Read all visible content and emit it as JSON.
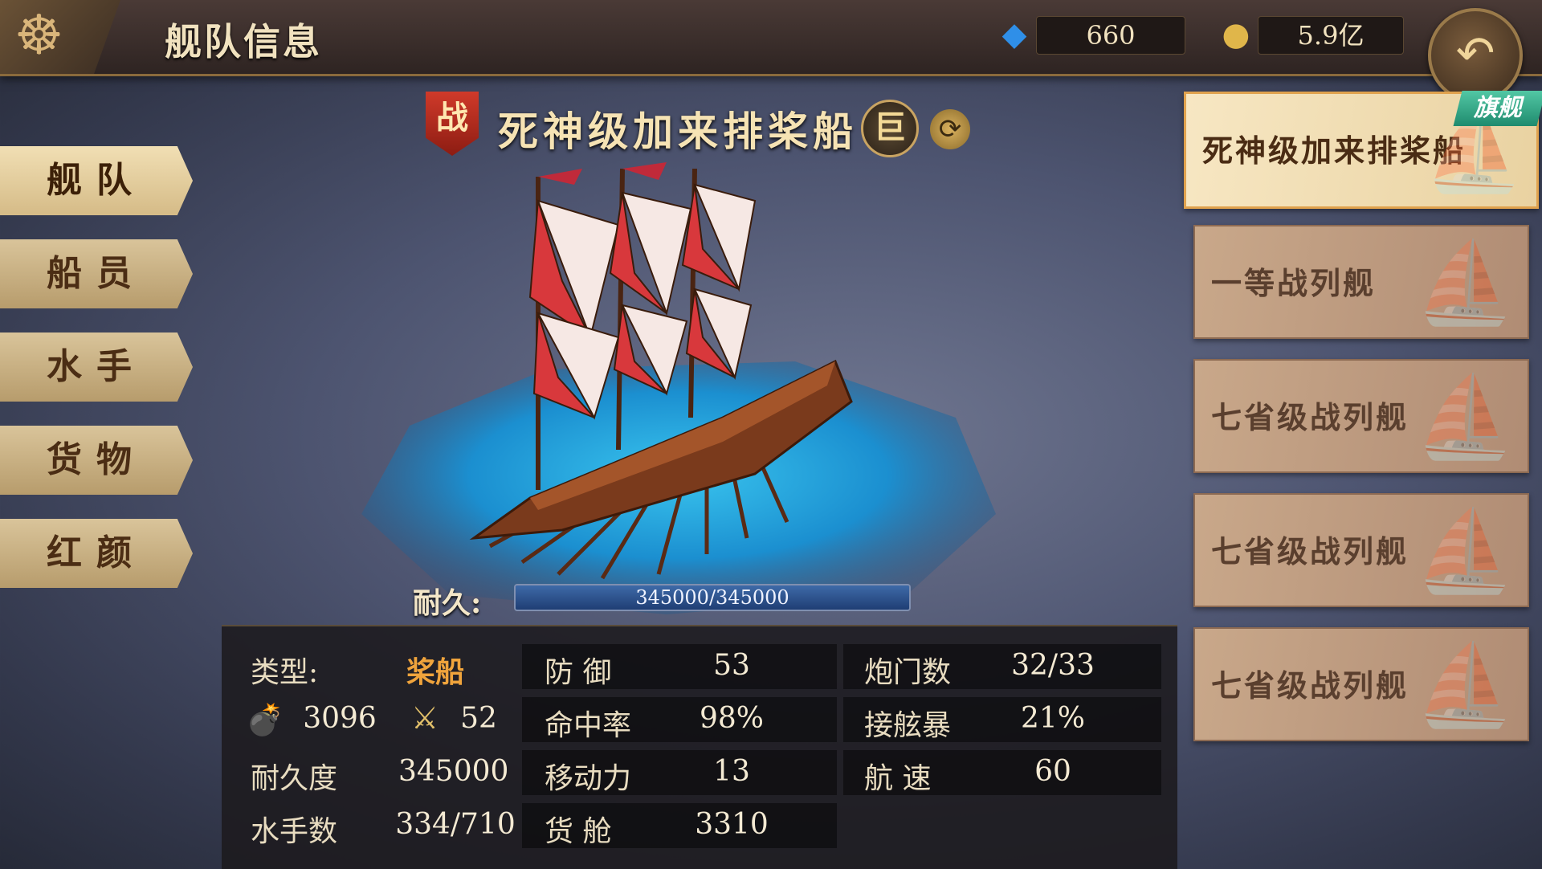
{
  "header": {
    "title": "舰队信息",
    "gems": "660",
    "gold": "5.9亿",
    "icons": {
      "menu": "ship-wheel-icon",
      "gems": "blue-gem-icon",
      "gold": "gold-coin-icon",
      "back": "back-arrow-icon"
    }
  },
  "tabs": [
    {
      "label": "舰队",
      "active": true
    },
    {
      "label": "船员",
      "active": false
    },
    {
      "label": "水手",
      "active": false
    },
    {
      "label": "货物",
      "active": false
    },
    {
      "label": "红颜",
      "active": false
    }
  ],
  "ship": {
    "battle_badge": "战",
    "name": "死神级加来排桨船",
    "size_badge": "巨",
    "durability_label": "耐久:",
    "durability_text": "345000/345000",
    "durability_fraction": 1.0
  },
  "stats": {
    "type_label": "类型:",
    "type_value": "桨船",
    "cannon_value": "3096",
    "melee_value": "52",
    "durability_label": "耐久度",
    "durability_value": "345000",
    "sailors_label": "水手数",
    "sailors_value": "334/710",
    "defense_label": "防 御",
    "defense_value": "53",
    "accuracy_label": "命中率",
    "accuracy_value": "98%",
    "mobility_label": "移动力",
    "mobility_value": "13",
    "cargo_label": "货 舱",
    "cargo_value": "3310",
    "gunports_label": "炮门数",
    "gunports_value": "32/33",
    "boarding_label": "接舷暴",
    "boarding_value": "21%",
    "speed_label": "航 速",
    "speed_value": "60"
  },
  "fleet": {
    "flagship_tag": "旗舰",
    "ships": [
      {
        "name": "死神级加来排桨船",
        "flagship": true
      },
      {
        "name": "一等战列舰",
        "flagship": false
      },
      {
        "name": "七省级战列舰",
        "flagship": false
      },
      {
        "name": "七省级战列舰",
        "flagship": false
      },
      {
        "name": "七省级战列舰",
        "flagship": false
      }
    ]
  },
  "colors": {
    "accent_gold": "#c9a462",
    "type_orange": "#f0a43c",
    "flag_green": "#1f8b6e",
    "sail_red": "#d8383c"
  }
}
